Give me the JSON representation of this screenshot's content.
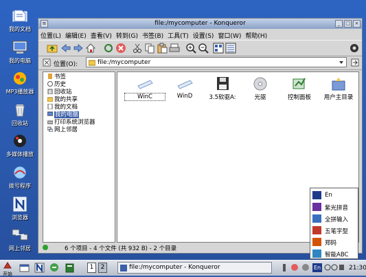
{
  "desktop_icons": [
    {
      "label": "我的文档",
      "icon": "documents-icon"
    },
    {
      "label": "我的电脑",
      "icon": "computer-icon"
    },
    {
      "label": "MP3播放器",
      "icon": "mp3-player-icon"
    },
    {
      "label": "回收站",
      "icon": "trash-icon"
    },
    {
      "label": "多媒体播放",
      "icon": "multimedia-icon"
    },
    {
      "label": "拨号程序",
      "icon": "dialer-icon"
    },
    {
      "label": "浏览器",
      "icon": "browser-icon"
    },
    {
      "label": "网上邻居",
      "icon": "network-icon"
    }
  ],
  "window": {
    "title": "file:/mycomputer - Konqueror",
    "menu": [
      "位置(L)",
      "编辑(E)",
      "查看(V)",
      "转到(G)",
      "书签(B)",
      "工具(T)",
      "设置(S)",
      "窗口(W)",
      "帮助(H)"
    ],
    "location_label": "位置(O):",
    "location_value": "file:/mycomputer"
  },
  "tree": [
    {
      "label": "书签"
    },
    {
      "label": "历史"
    },
    {
      "label": "回收站"
    },
    {
      "label": "我的共享"
    },
    {
      "label": "我的文档"
    },
    {
      "label": "我的电脑",
      "selected": true
    },
    {
      "label": "打印系统浏览器"
    },
    {
      "label": "网上邻居"
    }
  ],
  "files": [
    {
      "label": "WinC",
      "icon": "drive-c-icon"
    },
    {
      "label": "WinD",
      "icon": "drive-d-icon"
    },
    {
      "label": "3.5软驱A:",
      "icon": "floppy-icon"
    },
    {
      "label": "光驱",
      "icon": "cdrom-icon"
    },
    {
      "label": "控制面板",
      "icon": "control-panel-icon"
    },
    {
      "label": "用户主目录",
      "icon": "home-folder-icon"
    }
  ],
  "status": "6 个项目 - 4 个文件 (共 932 B) - 2 个目录",
  "ime_menu": [
    {
      "label": "En"
    },
    {
      "label": "紫光拼音"
    },
    {
      "label": "全拼输入"
    },
    {
      "label": "五笔字型"
    },
    {
      "label": "郑码"
    },
    {
      "label": "智能ABC"
    }
  ],
  "taskbar": {
    "start_label": "开始",
    "pager": [
      "1",
      "2"
    ],
    "task_title": "file:/mycomputer - Konqueror",
    "tray_text": "En",
    "clock": "21:30"
  },
  "colors": {
    "desktop": "#2d64c2",
    "selection": "#3b5fa8"
  }
}
